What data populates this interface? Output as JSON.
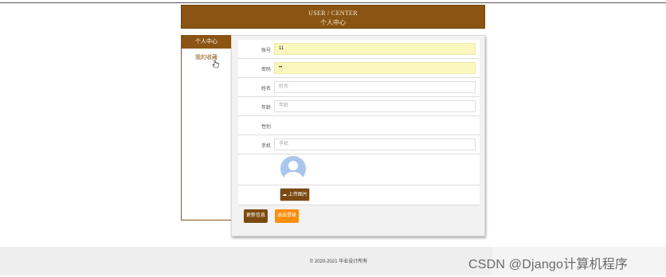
{
  "header": {
    "title_en": "USER / CENTER",
    "title_cn": "个人中心"
  },
  "sidebar": {
    "items": [
      {
        "label": "个人中心"
      },
      {
        "label": "我的收藏"
      }
    ]
  },
  "form": {
    "account": {
      "label": "账号",
      "value": "11"
    },
    "password": {
      "label": "密码",
      "value": "••"
    },
    "name": {
      "label": "姓名",
      "placeholder": "姓名"
    },
    "age": {
      "label": "年龄",
      "placeholder": "年龄"
    },
    "gender": {
      "label": "性别"
    },
    "phone": {
      "label": "手机",
      "placeholder": "手机"
    },
    "upload_label": "上传图片"
  },
  "actions": {
    "save_label": "更新信息",
    "logout_label": "退出登录"
  },
  "footer": {
    "copyright": "© 2020-2021 毕业设计所有"
  },
  "watermark": "CSDN @Django计算机程序",
  "colors": {
    "brand": "#8a5513",
    "accent": "#ff8c0a",
    "avatar": "#aac6ec"
  },
  "icons": [
    "pointer-hand-icon",
    "user-avatar-icon",
    "cloud-upload-icon"
  ]
}
